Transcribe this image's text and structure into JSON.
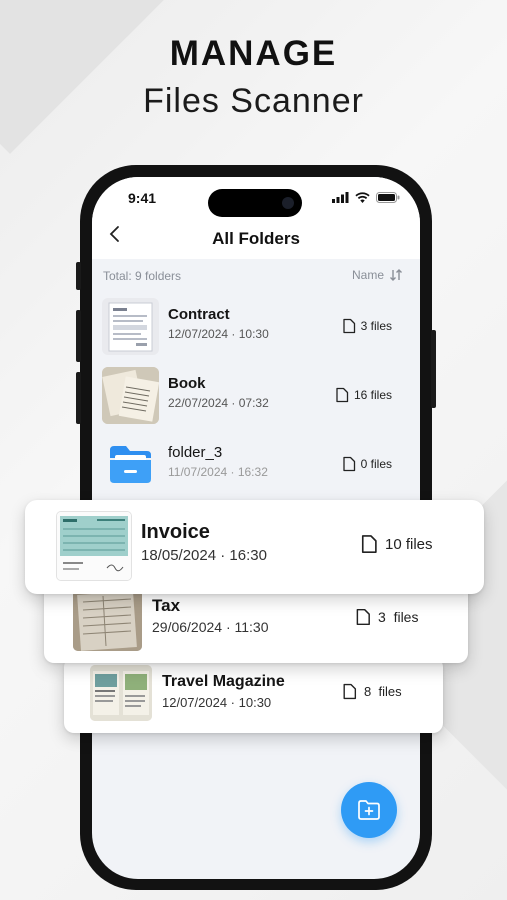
{
  "promo": {
    "title": "MANAGE",
    "subtitle": "Files Scanner"
  },
  "status_bar": {
    "time": "9:41"
  },
  "header": {
    "title": "All Folders"
  },
  "list_meta": {
    "total": "Total: 9 folders",
    "sort_label": "Name"
  },
  "folders": [
    {
      "name": "Contract",
      "date": "12/07/2024 · 10:30",
      "files": "3 files"
    },
    {
      "name": "Book",
      "date": "22/07/2024 · 07:32",
      "files": "16 files"
    },
    {
      "name": "folder_3",
      "date": "11/07/2024 · 16:32",
      "files": "0 files"
    }
  ],
  "cards": [
    {
      "name": "Invoice",
      "date": "18/05/2024 · 16:30",
      "files": "10 files"
    },
    {
      "name": "Tax",
      "date": "29/06/2024 · 11:30",
      "files": "3  files"
    },
    {
      "name": "Travel Magazine",
      "date": "12/07/2024 · 10:30",
      "files": "8  files"
    }
  ],
  "colors": {
    "accent": "#2f9bf5",
    "screen_bg": "#f1f3f7"
  },
  "icons": [
    "back-chevron-icon",
    "sort-icon",
    "file-icon",
    "folder-icon",
    "add-folder-icon",
    "signal-icon",
    "wifi-icon",
    "battery-icon"
  ]
}
